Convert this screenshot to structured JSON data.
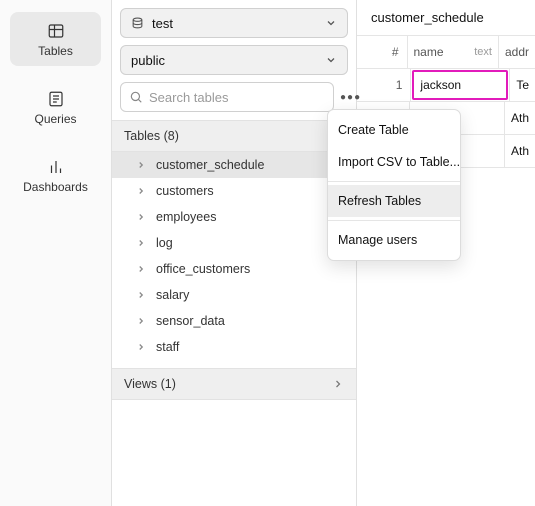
{
  "leftnav": {
    "items": [
      {
        "label": "Tables",
        "active": true
      },
      {
        "label": "Queries",
        "active": false
      },
      {
        "label": "Dashboards",
        "active": false
      }
    ]
  },
  "db_select": {
    "value": "test"
  },
  "schema_select": {
    "value": "public"
  },
  "search": {
    "placeholder": "Search tables"
  },
  "tables_header": "Tables (8)",
  "tables": [
    {
      "name": "customer_schedule",
      "selected": true
    },
    {
      "name": "customers",
      "selected": false
    },
    {
      "name": "employees",
      "selected": false
    },
    {
      "name": "log",
      "selected": false
    },
    {
      "name": "office_customers",
      "selected": false
    },
    {
      "name": "salary",
      "selected": false
    },
    {
      "name": "sensor_data",
      "selected": false
    },
    {
      "name": "staff",
      "selected": false
    }
  ],
  "views_header": "Views (1)",
  "right": {
    "title": "customer_schedule",
    "columns": {
      "idx": "#",
      "name": "name",
      "name_type": "text",
      "addr": "addr"
    },
    "rows": [
      {
        "idx": "1",
        "name": "jackson",
        "addr": "Te",
        "editing": true
      },
      {
        "idx": "",
        "name": "",
        "addr": "Ath",
        "editing": false
      },
      {
        "idx": "",
        "name": "",
        "addr": "Ath",
        "editing": false
      }
    ]
  },
  "context_menu": {
    "items": [
      "Create Table",
      "Import CSV to Table...",
      "Refresh Tables",
      "Manage users"
    ],
    "hover_index": 2
  }
}
